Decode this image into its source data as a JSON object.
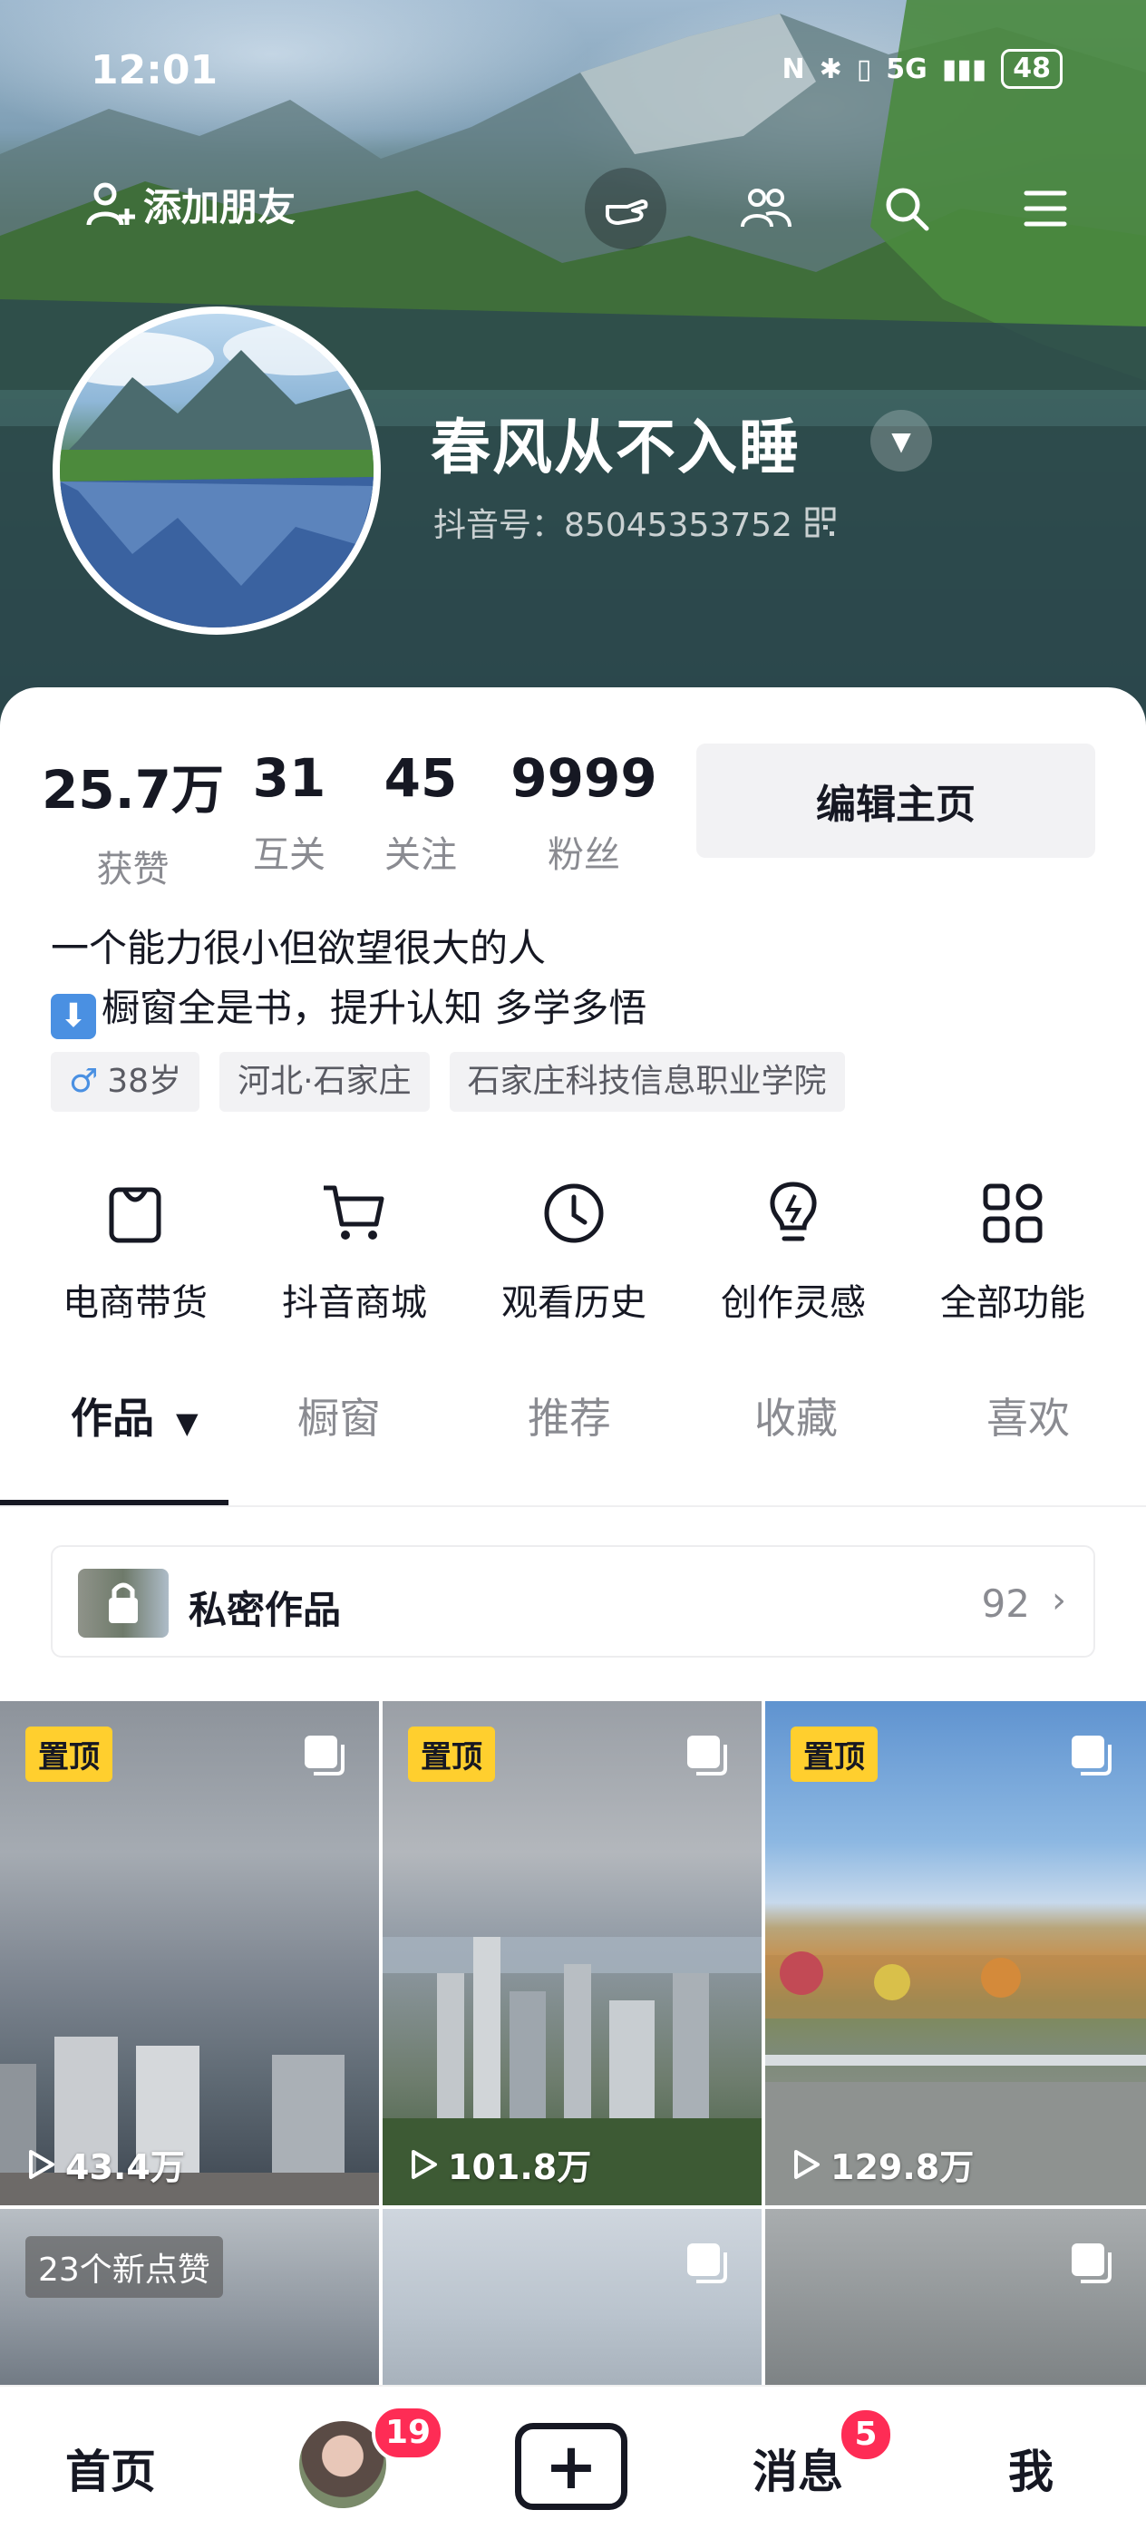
{
  "status_bar": {
    "time": "12:01",
    "network": "5G",
    "battery": "48"
  },
  "topbar": {
    "add_friend_label": "添加朋友"
  },
  "profile": {
    "username": "春风从不入睡",
    "douyin_id_label": "抖音号：",
    "douyin_id": "85045353752"
  },
  "stats": [
    {
      "value": "25.7万",
      "label": "获赞"
    },
    {
      "value": "31",
      "label": "互关"
    },
    {
      "value": "45",
      "label": "关注"
    },
    {
      "value": "9999",
      "label": "粉丝"
    }
  ],
  "edit_button": "编辑主页",
  "bio": {
    "line1": "一个能力很小但欲望很大的人",
    "line2_emoji": "⬇",
    "line2": "橱窗全是书，提升认知 多学多悟"
  },
  "tags": {
    "gender_symbol": "♂",
    "age": "38岁",
    "location": "河北·石家庄",
    "school": "石家庄科技信息职业学院"
  },
  "features": [
    {
      "icon": "shopping-bag-icon",
      "label": "电商带货"
    },
    {
      "icon": "cart-icon",
      "label": "抖音商城"
    },
    {
      "icon": "clock-icon",
      "label": "观看历史"
    },
    {
      "icon": "lightbulb-icon",
      "label": "创作灵感"
    },
    {
      "icon": "grid-icon",
      "label": "全部功能"
    }
  ],
  "tabs": [
    {
      "label": "作品",
      "active": true
    },
    {
      "label": "橱窗"
    },
    {
      "label": "推荐"
    },
    {
      "label": "收藏"
    },
    {
      "label": "喜欢"
    }
  ],
  "private_works": {
    "title": "私密作品",
    "count": "92"
  },
  "videos": [
    {
      "pinned_label": "置顶",
      "plays": "43.4万"
    },
    {
      "pinned_label": "置顶",
      "plays": "101.8万"
    },
    {
      "pinned_label": "置顶",
      "plays": "129.8万"
    },
    {
      "likes_badge": "23个新点赞"
    },
    {},
    {}
  ],
  "bottom_nav": {
    "home": "首页",
    "friends_badge": "19",
    "messages": "消息",
    "messages_badge": "5",
    "me": "我"
  },
  "colors": {
    "accent": "#fe2c55",
    "pin": "#ffcf2e",
    "text": "#161823",
    "muted": "#8a8b91"
  }
}
